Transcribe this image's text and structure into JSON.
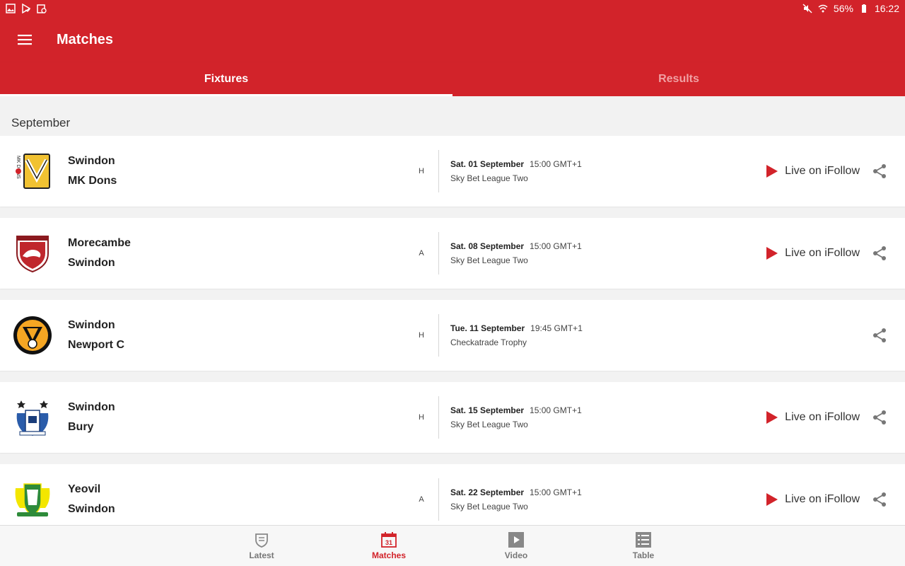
{
  "status_bar": {
    "battery": "56%",
    "time": "16:22"
  },
  "app_bar": {
    "title": "Matches"
  },
  "tabs": [
    {
      "label": "Fixtures",
      "active": true
    },
    {
      "label": "Results",
      "active": false
    }
  ],
  "section": {
    "month": "September"
  },
  "matches": [
    {
      "home": "Swindon",
      "away": "MK Dons",
      "venue": "H",
      "date": "Sat. 01 September",
      "time": "15:00 GMT+1",
      "competition": "Sky Bet League Two",
      "live": "Live on iFollow",
      "crest": "mk-dons-crest"
    },
    {
      "home": "Morecambe",
      "away": "Swindon",
      "venue": "A",
      "date": "Sat. 08 September",
      "time": "15:00 GMT+1",
      "competition": "Sky Bet League Two",
      "live": "Live on iFollow",
      "crest": "morecambe-crest"
    },
    {
      "home": "Swindon",
      "away": "Newport C",
      "venue": "H",
      "date": "Tue. 11 September",
      "time": "19:45 GMT+1",
      "competition": "Checkatrade Trophy",
      "live": "",
      "crest": "newport-county-crest"
    },
    {
      "home": "Swindon",
      "away": "Bury",
      "venue": "H",
      "date": "Sat. 15 September",
      "time": "15:00 GMT+1",
      "competition": "Sky Bet League Two",
      "live": "Live on iFollow",
      "crest": "bury-crest"
    },
    {
      "home": "Yeovil",
      "away": "Swindon",
      "venue": "A",
      "date": "Sat. 22 September",
      "time": "15:00 GMT+1",
      "competition": "Sky Bet League Two",
      "live": "Live on iFollow",
      "crest": "yeovil-town-crest"
    }
  ],
  "bottom_nav": [
    {
      "label": "Latest",
      "icon": "swindon-crest-icon",
      "active": false
    },
    {
      "label": "Matches",
      "icon": "calendar-icon",
      "calendar_day": "31",
      "active": true
    },
    {
      "label": "Video",
      "icon": "video-play-icon",
      "active": false
    },
    {
      "label": "Table",
      "icon": "table-list-icon",
      "active": false
    }
  ],
  "colors": {
    "brand_red": "#d2232a",
    "inactive_tab": "#f0a0a3"
  }
}
